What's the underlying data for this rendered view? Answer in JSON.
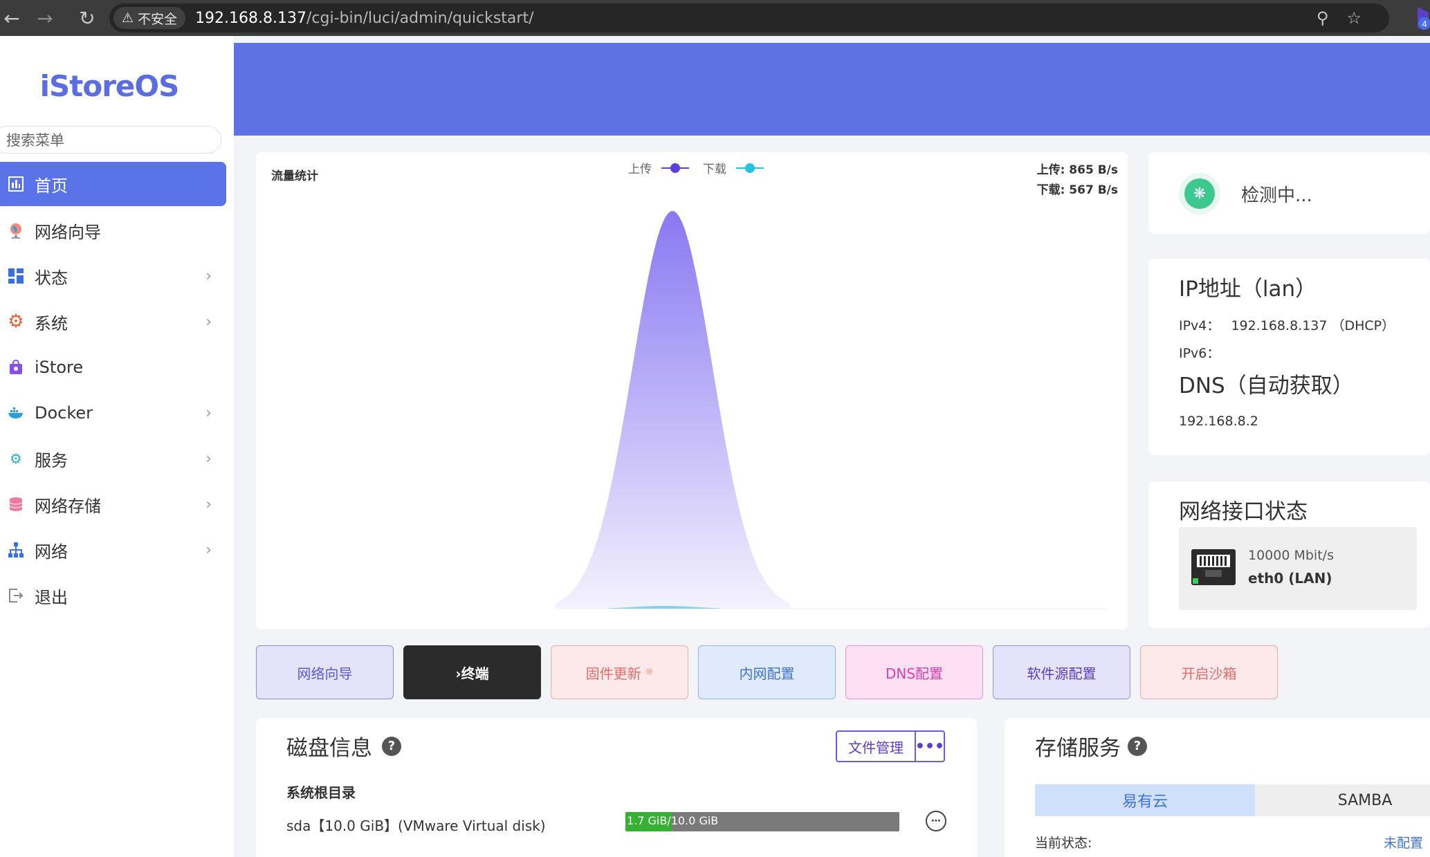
{
  "browser": {
    "security_label": "不安全",
    "url_host": "192.168.8.137",
    "url_path": "/cgi-bin/luci/admin/quickstart/",
    "ext_badge": "4"
  },
  "sidebar": {
    "logo": "iStoreOS",
    "search_placeholder": "搜索菜单",
    "items": [
      {
        "label": "首页",
        "icon": "dashboard-icon"
      },
      {
        "label": "网络向导",
        "icon": "globe-icon"
      },
      {
        "label": "状态",
        "icon": "grid-icon"
      },
      {
        "label": "系统",
        "icon": "gear-icon"
      },
      {
        "label": "iStore",
        "icon": "bag-icon"
      },
      {
        "label": "Docker",
        "icon": "docker-icon"
      },
      {
        "label": "服务",
        "icon": "gears-icon"
      },
      {
        "label": "网络存储",
        "icon": "database-icon"
      },
      {
        "label": "网络",
        "icon": "network-icon"
      },
      {
        "label": "退出",
        "icon": "logout-icon"
      }
    ]
  },
  "traffic": {
    "title": "流量统计",
    "legend_upload": "上传",
    "legend_download": "下载",
    "upload_rate": "上传: 865 B/s",
    "download_rate": "下载: 567 B/s",
    "upload_color": "#5b3fe0",
    "download_color": "#22c3e6"
  },
  "chart_data": {
    "type": "area",
    "title": "流量统计",
    "series": [
      {
        "name": "上传",
        "peak_position": 0.35,
        "color": "#7b6cf0"
      },
      {
        "name": "下载",
        "peak_position": 0.18,
        "color": "#22c3e6"
      }
    ],
    "grid": false,
    "legend_position": "top-center"
  },
  "detect": {
    "label": "检测中..."
  },
  "ip": {
    "title": "IP地址（lan）",
    "ipv4_label": "IPv4：",
    "ipv4_value": "192.168.8.137 （DHCP）",
    "ipv6_label": "IPv6：",
    "dns_title": "DNS（自动获取）",
    "dns_value": "192.168.8.2"
  },
  "netif": {
    "title": "网络接口状态",
    "speed": "10000 Mbit/s",
    "name": "eth0 (LAN)"
  },
  "quick_buttons": [
    "网络向导",
    "›终端",
    "固件更新",
    "内网配置",
    "DNS配置",
    "软件源配置",
    "开启沙箱"
  ],
  "disk": {
    "title": "磁盘信息",
    "file_manager": "文件管理",
    "more": "•••",
    "root_label": "系统根目录",
    "disk_name": "sda【10.0 GiB】(VMware Virtual disk)",
    "usage_text": "1.7 GiB/10.0 GiB",
    "usage_fraction": 0.17
  },
  "storage": {
    "title": "存储服务",
    "tabs": [
      "易有云",
      "SAMBA"
    ],
    "status_label": "当前状态:",
    "status_value": "未配置"
  }
}
